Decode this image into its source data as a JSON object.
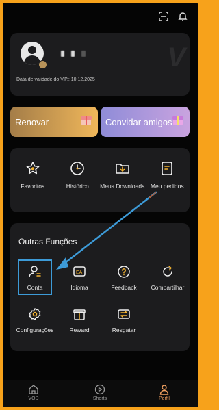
{
  "colors": {
    "accent": "#f0a060",
    "highlight": "#3d9bd8",
    "background": "#050505",
    "card": "#1c1c1e",
    "border": "#f7a21b"
  },
  "topbar": {
    "icons": [
      "scan-icon",
      "bell-icon"
    ]
  },
  "profile": {
    "validity": "Data de validade do V.P.: 10.12.2025",
    "watermark": "V"
  },
  "promos": {
    "renovar": "Renovar",
    "convidar": "Convidar amigos"
  },
  "quick_actions": [
    {
      "label": "Favoritos",
      "icon": "star-icon"
    },
    {
      "label": "Histórico",
      "icon": "clock-icon"
    },
    {
      "label": "Meus Downloads",
      "icon": "download-folder-icon"
    },
    {
      "label": "Meu pedidos",
      "icon": "order-icon"
    }
  ],
  "other_functions": {
    "title": "Outras Funções",
    "items": [
      {
        "label": "Conta",
        "icon": "account-icon"
      },
      {
        "label": "Idioma",
        "icon": "language-icon"
      },
      {
        "label": "Feedback",
        "icon": "feedback-icon"
      },
      {
        "label": "Compartilhar",
        "icon": "share-icon"
      },
      {
        "label": "Configurações",
        "icon": "settings-icon"
      },
      {
        "label": "Reward",
        "icon": "reward-icon"
      },
      {
        "label": "Resgatar",
        "icon": "redeem-icon"
      }
    ]
  },
  "nav": {
    "tabs": [
      {
        "label": "VOD",
        "icon": "home-icon"
      },
      {
        "label": "Shorts",
        "icon": "play-icon"
      },
      {
        "label": "Perfil",
        "icon": "profile-icon",
        "active": true
      }
    ]
  }
}
